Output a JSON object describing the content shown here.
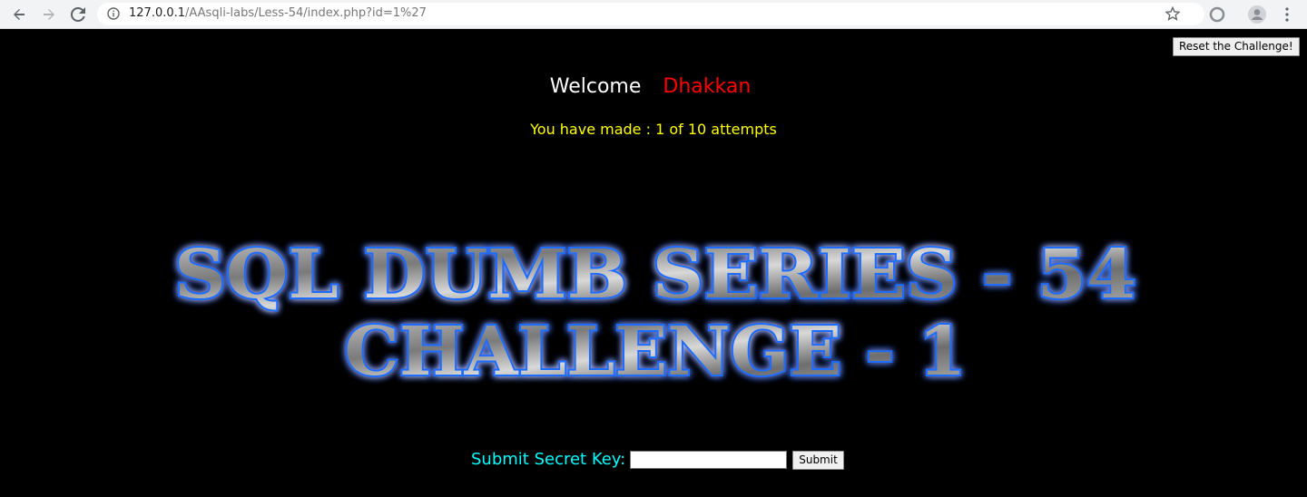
{
  "browser": {
    "url_host": "127.0.0.1",
    "url_path": "/AAsqli-labs/Less-54/index.php?id=1%27",
    "icons": {
      "back": "back-arrow-icon",
      "forward": "forward-arrow-icon",
      "reload": "reload-icon",
      "info": "info-icon",
      "bookmark": "star-icon",
      "extension": "extension-icon",
      "profile": "profile-icon",
      "menu": "menu-icon"
    }
  },
  "page": {
    "reset_label": "Reset the Challenge!",
    "welcome_label": "Welcome",
    "username": "Dhakkan",
    "attempts_text": "You have made : 1 of 10 attempts",
    "banner_line1": "SQL DUMB SERIES - 54",
    "banner_line2": "CHALLENGE - 1",
    "secret_label": "Submit Secret Key:",
    "secret_value": "",
    "submit_label": "Submit",
    "colors": {
      "background": "#000000",
      "welcome": "#ffffff",
      "username": "#ff0000",
      "attempts": "#ffff00",
      "secret_label": "#00ffff",
      "banner_glow": "#1e6cff"
    }
  }
}
